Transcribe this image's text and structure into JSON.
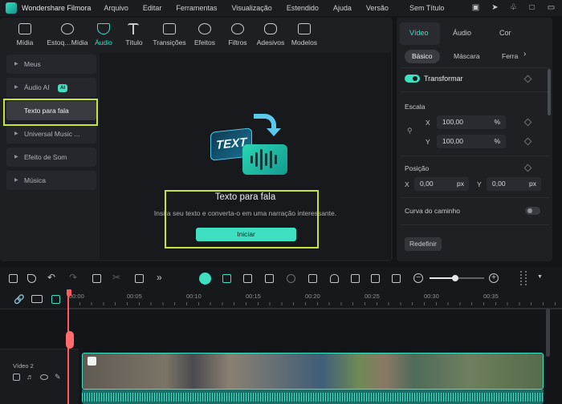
{
  "menubar": {
    "app_name": "Wondershare Filmora",
    "menus": [
      "Arquivo",
      "Editar",
      "Ferramentas",
      "Visualização",
      "Estendido",
      "Ajuda",
      "Versão"
    ],
    "doc_title": "Sem Título"
  },
  "media_toolbar": {
    "tabs": [
      {
        "label": "Mídia",
        "icon": "media-icon"
      },
      {
        "label": "Estoq…Mídia",
        "icon": "stock-media-icon"
      },
      {
        "label": "Áudio",
        "icon": "music-note-icon",
        "active": true
      },
      {
        "label": "Título",
        "icon": "title-icon"
      },
      {
        "label": "Transições",
        "icon": "transitions-icon"
      },
      {
        "label": "Efeitos",
        "icon": "effects-icon"
      },
      {
        "label": "Filtros",
        "icon": "filters-icon"
      },
      {
        "label": "Adesivos",
        "icon": "stickers-icon"
      },
      {
        "label": "Modelos",
        "icon": "templates-icon"
      }
    ]
  },
  "sidebar": {
    "items": [
      {
        "label": "Meus"
      },
      {
        "label": "Áudio AI",
        "badge": "AI"
      },
      {
        "label": "Texto para fala",
        "selected": true
      },
      {
        "label": "Universal Music ..."
      },
      {
        "label": "Efeito de Som"
      },
      {
        "label": "Música"
      }
    ]
  },
  "tts": {
    "art_text": "TEXT",
    "title": "Texto para fala",
    "description": "Insira seu texto e converta-o em uma narração interessante.",
    "start_label": "Iniciar"
  },
  "props": {
    "tabs": [
      "Vídeo",
      "Áudio",
      "Cor"
    ],
    "subtabs": [
      "Básico",
      "Máscara",
      "Ferra"
    ],
    "transform_label": "Transformar",
    "scale_label": "Escala",
    "scale_x": {
      "axis": "X",
      "value": "100,00",
      "unit": "%"
    },
    "scale_y": {
      "axis": "Y",
      "value": "100,00",
      "unit": "%"
    },
    "position_label": "Posição",
    "pos_x": {
      "axis": "X",
      "value": "0,00",
      "unit": "px"
    },
    "pos_y": {
      "axis": "Y",
      "value": "0,00",
      "unit": "px"
    },
    "path_curve_label": "Curva do caminho",
    "reset_label": "Redefinir"
  },
  "timeline": {
    "ruler": [
      "00:00",
      "00:05",
      "00:10",
      "00:15",
      "00:20",
      "00:25",
      "00:30",
      "00:35"
    ],
    "track_label": "Vídeo 2"
  },
  "colors": {
    "accent": "#3fe0c1",
    "highlight": "#c6e33a"
  }
}
